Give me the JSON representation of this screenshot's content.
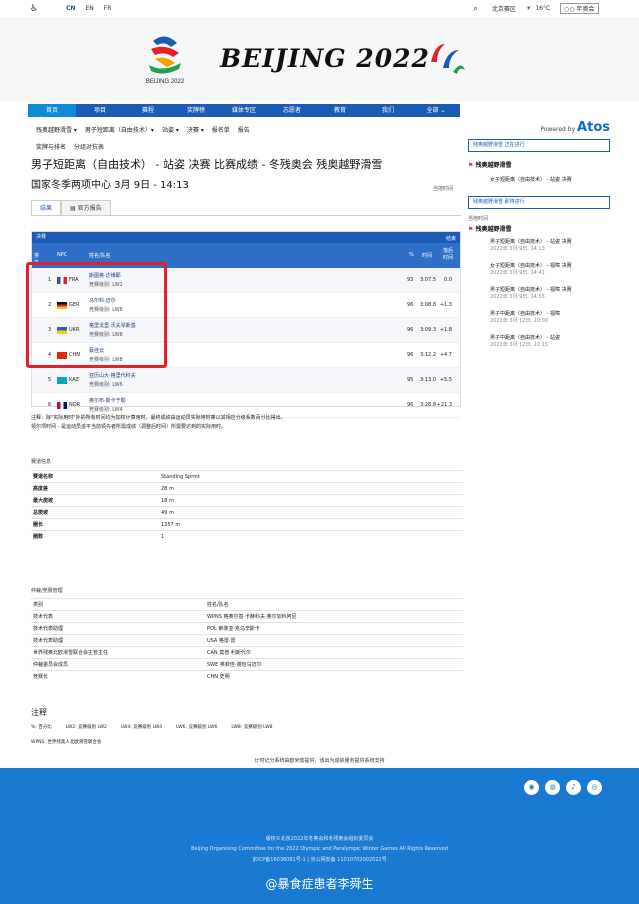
{
  "topbar": {
    "langs": [
      "CN",
      "EN",
      "FR"
    ],
    "venue": "北京赛区",
    "temp": "16°C",
    "days": "年奥会"
  },
  "header": {
    "logo_text": "BEIJING 2022",
    "logo_sub": "BEIJING 2022"
  },
  "nav": [
    "首页",
    "项目",
    "赛程",
    "奖牌榜",
    "媒体专区",
    "志愿者",
    "教育",
    "我们",
    "全部 ⌄"
  ],
  "subnav": [
    "残奥越野滑雪 ▾",
    "男子短距离（自由技术）▾",
    "站姿 ▾",
    "决赛 ▾",
    "报名单",
    "报告"
  ],
  "subnav2": [
    "奖牌与排名",
    "分组对抗表"
  ],
  "title": "男子短距离（自由技术） - 站姿 决赛 比赛成绩 - 冬残奥会 残奥越野滑雪",
  "subtitle": "国家冬季两项中心 3月 9日 - 14:13",
  "localtime": "当地时间",
  "tabs": [
    "结果",
    "官方报告"
  ],
  "results": {
    "caption": "决赛",
    "status": "结束",
    "headers": {
      "rank": "排名",
      "npc": "NPC",
      "name": "姓名/队名",
      "pct": "%",
      "time": "时间",
      "behind": "落后时间"
    },
    "rows": [
      {
        "rank": "1",
        "npc": "FRA",
        "name": "斯图奥·达维耶",
        "class": "竞赛级别: LW2",
        "pct": "93",
        "time": "3:07.5",
        "behind": "0.0",
        "flag": [
          "#2a53a8",
          "#ffffff",
          "#d8262d"
        ]
      },
      {
        "rank": "2",
        "npc": "GER",
        "name": "马尔科·迈尔",
        "class": "竞赛级别: LW8",
        "pct": "96",
        "time": "3:08.8",
        "behind": "+1.3",
        "flag": [
          "#111111",
          "#d8262d",
          "#f5c400"
        ]
      },
      {
        "rank": "3",
        "npc": "UKR",
        "name": "格里戈里·沃夫琴斯基",
        "class": "竞赛级别: LW8",
        "pct": "96",
        "time": "3:09.3",
        "behind": "+1.8",
        "flag": [
          "#2a5fc4",
          "#f5d100"
        ]
      },
      {
        "rank": "4",
        "npc": "CHN",
        "name": "蔡佳云",
        "class": "竞赛级别: LW8",
        "pct": "96",
        "time": "3:12.2",
        "behind": "+4.7",
        "flag": [
          "#de2910"
        ]
      },
      {
        "rank": "5",
        "npc": "KAZ",
        "name": "亚历山大·格里代科夫",
        "class": "竞赛级别: LW6",
        "pct": "95",
        "time": "3:13.0",
        "behind": "+5.5",
        "flag": [
          "#00a5c8"
        ]
      },
      {
        "rank": "6",
        "npc": "NOR",
        "name": "奥尔布·斯卡于勒",
        "class": "竞赛级别: LW4",
        "pct": "96",
        "time": "3:28.8",
        "behind": "+21.3",
        "flag": [
          "#c8102e",
          "#ffffff",
          "#00205b"
        ]
      }
    ]
  },
  "note1": "注释：除\"实际用时\"外的所有时间均为加权计算用时。最终成绩由运动员实际用时乘以其相应分级系数百分比得出。",
  "note2": "领尔项时间 - 是运动员追平当前领先者所需成绩（调整后时间）所需要达到的实际用时。",
  "venue": {
    "title": "赛道信息",
    "rows": [
      [
        "赛道名称",
        "Standing Sprint"
      ],
      [
        "高度差",
        "28 m"
      ],
      [
        "最大爬坡",
        "18 m"
      ],
      [
        "总爬坡",
        "49 m"
      ],
      [
        "圈长",
        "1357 m"
      ],
      [
        "圈数",
        "1"
      ]
    ]
  },
  "officials": {
    "title": "仲裁/竞赛管理",
    "col1": "类别",
    "col2": "姓名/队名",
    "rows": [
      [
        "技术代表",
        "WPNS 格奥尔基·卡赫科夫·奥尔加科阿尼"
      ],
      [
        "技术代表助理",
        "POL 索菲亚·克乌辛斯卡"
      ],
      [
        "技术代表助理",
        "USA 格雷·雷"
      ],
      [
        "世界残奥北欧滑雪联合会主管主任",
        "CAN 莫普·利斯代尔"
      ],
      [
        "仲裁委员会成员",
        "SWE 英菲佳·谢恰乌迈尔"
      ],
      [
        "竞赛长",
        "CHN 史明"
      ]
    ]
  },
  "legend": {
    "title": "注释",
    "items": [
      "%: 百分比",
      "LW2: 竞赛级别 LW2",
      "LW4: 竞赛级别 LW4",
      "LW6: 竞赛级别 LW6",
      "LW8: 竞赛级别 LW8"
    ],
    "wpns": "WPNS: 世界残奥人北欧滑雪联合会"
  },
  "timing": "计时记分系统由欧米茄提供，该出为成绩服务提供系统支持",
  "sidebar": {
    "powered": "Powered by",
    "brand": "Atos",
    "live_btn": "残奥越野滑雪 正在进行",
    "sport1": "残奥越野滑雪",
    "live_event": "女子短距离（自由技术） - 站姿 决赛",
    "upcoming_btn": "残奥越野滑雪 即将进行",
    "localtime": "当地时间",
    "sport2": "残奥越野滑雪",
    "schedule": [
      {
        "name": "男子短距离（自由技术） - 站姿 决赛",
        "date": "2022年 3月 9日, 14:13"
      },
      {
        "name": "女子短距离（自由技术） - 视障 决赛",
        "date": "2022年 3月 9日, 14:41"
      },
      {
        "name": "男子短距离（自由技术） - 视障 决赛",
        "date": "2022年 3月 9日, 14:55"
      },
      {
        "name": "男子中距离（自由技术） - 视障",
        "date": "2022年 3月 12日, 10:00"
      },
      {
        "name": "男子中距离（自由技术） - 站姿",
        "date": "2022年 3月 12日, 10:15"
      }
    ]
  },
  "footer": {
    "line1": "版权©北京2022年冬奥会和冬残奥会组织委员会",
    "line2": "Beijing Organising Committee for the 2022 Olympic and Paralympic Winter Games All Rights Reserved",
    "line3": "京ICP备16036081号-1 | 京公网安备 11010702002022号",
    "watermark": "@暴食症患者李舜生"
  },
  "colors": {
    "nav": "#1a5bb3",
    "active": "#0f8ad9",
    "footer": "#1a7ad1",
    "highlight": "#e4202b"
  }
}
